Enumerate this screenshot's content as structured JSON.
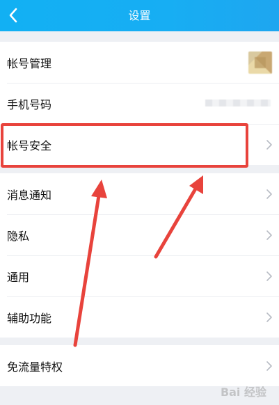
{
  "header": {
    "title": "设置",
    "back_icon": "chevron-left-icon"
  },
  "settings": {
    "group1": [
      {
        "label": "帐号管理",
        "trailing": "avatar"
      },
      {
        "label": "手机号码",
        "trailing": "blurred-phone"
      },
      {
        "label": "帐号安全",
        "trailing": "chevron-right-icon"
      }
    ],
    "group2": [
      {
        "label": "消息通知",
        "trailing": "chevron-right-icon"
      },
      {
        "label": "隐私",
        "trailing": "chevron-right-icon"
      },
      {
        "label": "通用",
        "trailing": "chevron-right-icon"
      },
      {
        "label": "辅助功能",
        "trailing": "chevron-right-icon"
      }
    ],
    "group3": [
      {
        "label": "免流量特权",
        "trailing": "chevron-right-icon"
      }
    ]
  },
  "annotation": {
    "highlight_color": "#e8433c"
  },
  "watermark": {
    "text": "Bai 经验"
  },
  "colors": {
    "header": "#17aef3",
    "background": "#eef0f4",
    "arrow": "#e8433c"
  }
}
